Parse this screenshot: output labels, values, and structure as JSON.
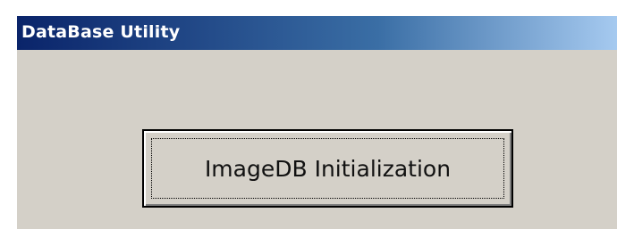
{
  "window": {
    "title": "DataBase Utility"
  },
  "main": {
    "init_button_label": "ImageDB Initialization"
  },
  "colors": {
    "titlebar_start": "#0a246a",
    "titlebar_end": "#a6caf0",
    "face": "#d4d0c8"
  }
}
